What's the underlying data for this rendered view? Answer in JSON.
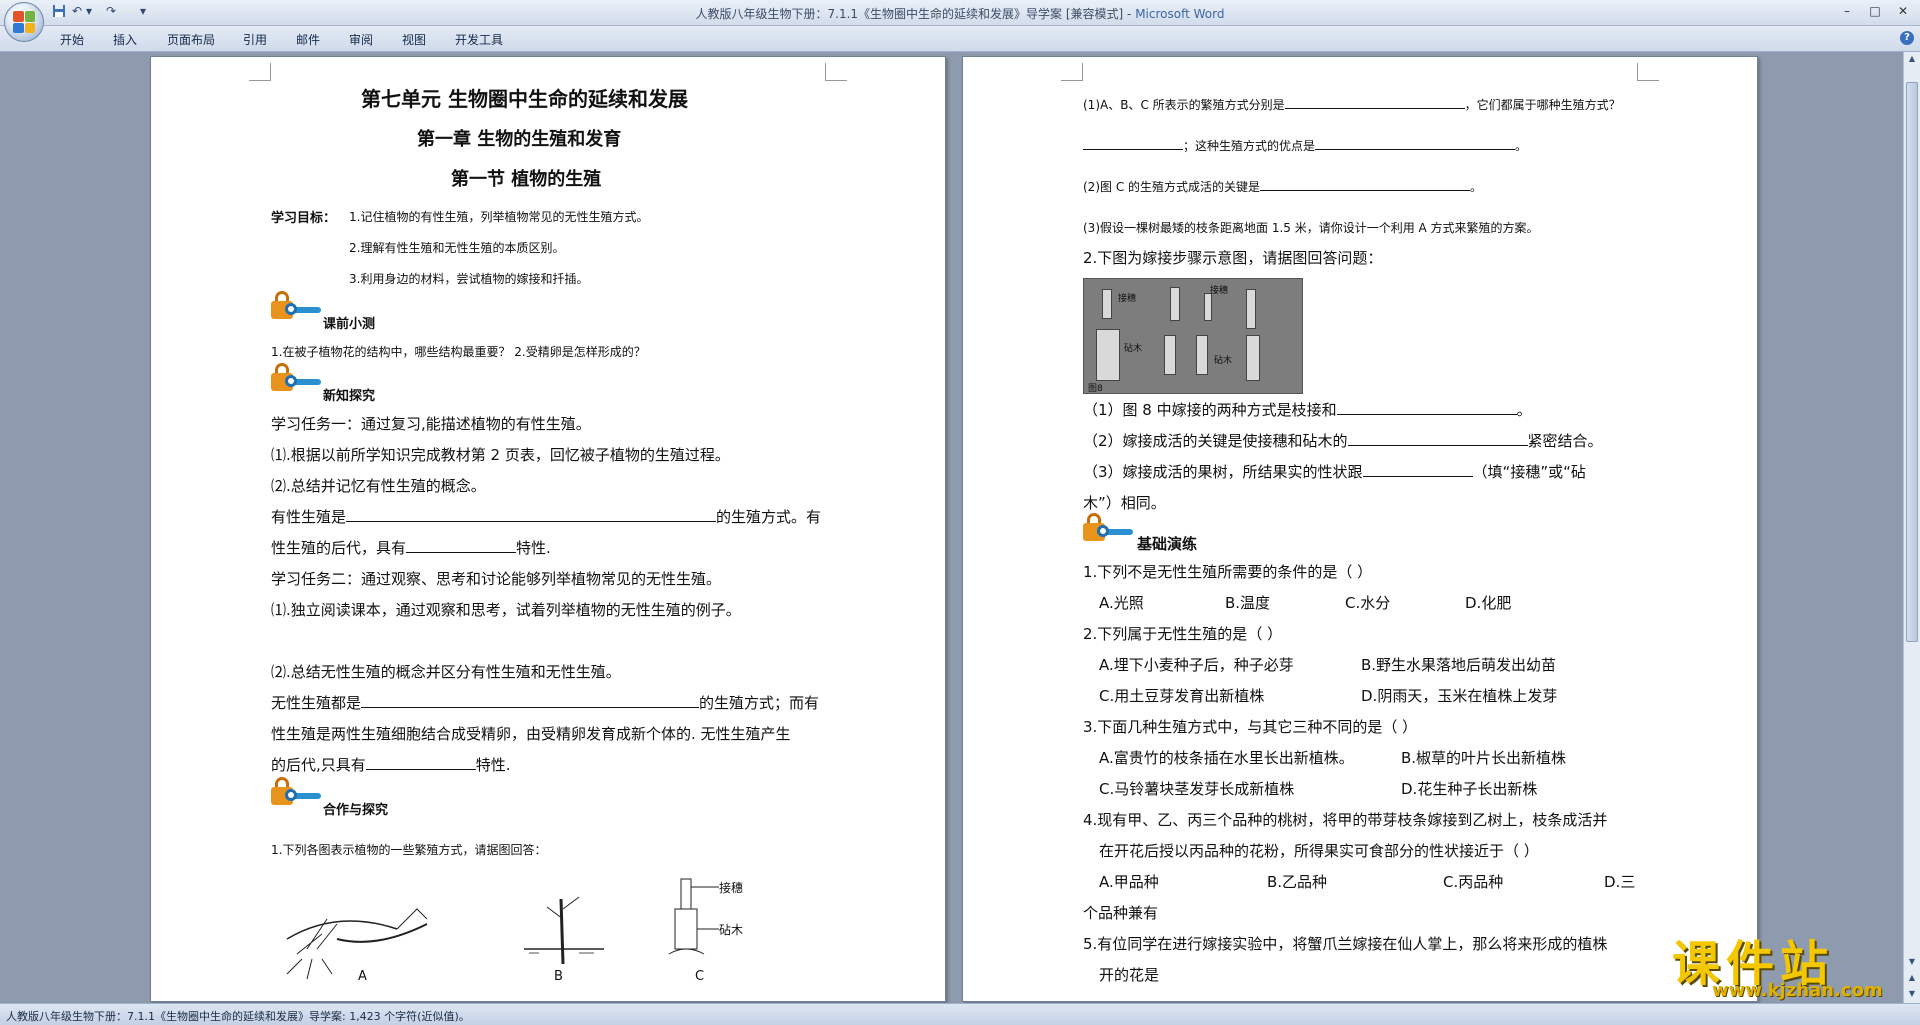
{
  "window": {
    "title": "人教版八年级生物下册：7.1.1《生物圈中生命的延续和发展》导学案 [兼容模式] - ",
    "app_name": "Microsoft Word",
    "minimize": "–",
    "maximize": "□",
    "close": "✕"
  },
  "quick_access": {
    "undo": "↶",
    "redo": "↷",
    "more": "▾"
  },
  "ribbon": {
    "tabs": [
      "开始",
      "插入",
      "页面布局",
      "引用",
      "邮件",
      "审阅",
      "视图",
      "开发工具"
    ],
    "help": "?"
  },
  "page1": {
    "title_unit": "第七单元   生物圈中生命的延续和发展",
    "title_chapter": "第一章    生物的生殖和发育",
    "title_section": "第一节    植物的生殖",
    "goals_label": "学习目标：",
    "goals": [
      "1.记住植物的有性生殖，列举植物常见的无性生殖方式。",
      "2.理解有性生殖和无性生殖的本质区别。",
      "3.利用身边的材料，尝试植物的嫁接和扦插。"
    ],
    "sec_pretest": "课前小测",
    "pretest_q": "1.在被子植物花的结构中，哪些结构最重要？   2.受精卵是怎样形成的？",
    "sec_explore": "新知探究",
    "task1": "学习任务一：通过复习,能描述植物的有性生殖。",
    "task1_a": "⑴.根据以前所学知识完成教材第 2 页表，回忆被子植物的生殖过程。",
    "task1_b": "⑵.总结并记忆有性生殖的概念。",
    "sexual_def_1a": "有性生殖是",
    "sexual_def_1b": "的生殖方式。有",
    "sexual_def_2a": "性生殖的后代，具有",
    "sexual_def_2b": "特性.",
    "task2": "学习任务二：通过观察、思考和讨论能够列举植物常见的无性生殖。",
    "task2_a": "⑴.独立阅读课本，通过观察和思考，试着列举植物的无性生殖的例子。",
    "task2_b": "⑵.总结无性生殖的概念并区分有性生殖和无性生殖。",
    "asexual_1a": "无性生殖都是",
    "asexual_1b": "的生殖方式；而有",
    "asexual_2": "性生殖是两性生殖细胞结合成受精卵，由受精卵发育成新个体的.  无性生殖产生",
    "asexual_3a": "的后代,只具有",
    "asexual_3b": "特性.",
    "sec_coop": "合作与探究",
    "coop_q1": "1.下列各图表示植物的一些繁殖方式，请据图回答：",
    "fig_labels": [
      "A",
      "B",
      "C"
    ],
    "fig_c_labels": [
      "接穗",
      "砧木"
    ]
  },
  "page2": {
    "q1_1a": "(1)A、B、C 所表示的繁殖方式分别是",
    "q1_1b": "，它们都属于哪种生殖方式？",
    "q1_1c": "；这种生殖方式的优点是",
    "q1_2": "(2)图 C 的生殖方式成活的关键是",
    "q1_3": "(3)假设一棵树最矮的枝条距离地面 1.5 米，请你设计一个利用 A 方式来繁殖的方案。",
    "q2": "2.下图为嫁接步骤示意图，请据图回答问题：",
    "photo_labels": [
      "接穗",
      "接穗",
      "砧木",
      "砧木",
      "图8"
    ],
    "q2_1a": "（1）图 8 中嫁接的两种方式是枝接和",
    "q2_2a": "（2）嫁接成活的关键是使接穗和砧木的",
    "q2_2b": "紧密结合。",
    "q2_3a": "（3）嫁接成活的果树，所结果实的性状跟",
    "q2_3b": "（填“接穗”或“砧",
    "q2_3c": "木”）相同。",
    "sec_basic": "基础演练",
    "b1": "1.下列不是无性生殖所需要的条件的是（      ）",
    "b1_opts": [
      "A.光照",
      "B.温度",
      "C.水分",
      "D.化肥"
    ],
    "b2": "2.下列属于无性生殖的是（      ）",
    "b2_opts": [
      "A.埋下小麦种子后，种子必芽",
      "B.野生水果落地后萌发出幼苗",
      "C.用土豆芽发育出新植株",
      "D.阴雨天，玉米在植株上发芽"
    ],
    "b3": "3.下面几种生殖方式中，与其它三种不同的是（      ）",
    "b3_opts": [
      "A.富贵竹的枝条插在水里长出新植株。",
      "B.椒草的叶片长出新植株",
      "C.马铃薯块茎发芽长成新植株",
      "D.花生种子长出新株"
    ],
    "b4_1": "4.现有甲、乙、丙三个品种的桃树，将甲的带芽枝条嫁接到乙树上，枝条成活并",
    "b4_2": "在开花后授以丙品种的花粉，所得果实可食部分的性状接近于（      ）",
    "b4_opts": [
      "A.甲品种",
      "B.乙品种",
      "C.丙品种",
      "D.三"
    ],
    "b4_tail": "个品种兼有",
    "b5_1": "5.有位同学在进行嫁接实验中，将蟹爪兰嫁接在仙人掌上，那么将来形成的植株",
    "b5_2": "开的花是"
  },
  "status": {
    "text": "人教版八年级生物下册：7.1.1《生物圈中生命的延续和发展》导学案: 1,423 个字符(近似值)。"
  },
  "watermark": {
    "cn": "课件站",
    "url": "www.kjzhan.com"
  },
  "colors": {
    "title_bar": "#dce5f1",
    "app_name": "#3b66a5",
    "workspace": "#8e9aad",
    "lock_orange": "#e7931c",
    "key_blue": "#2c8fd0",
    "watermark": "#f4c800"
  }
}
